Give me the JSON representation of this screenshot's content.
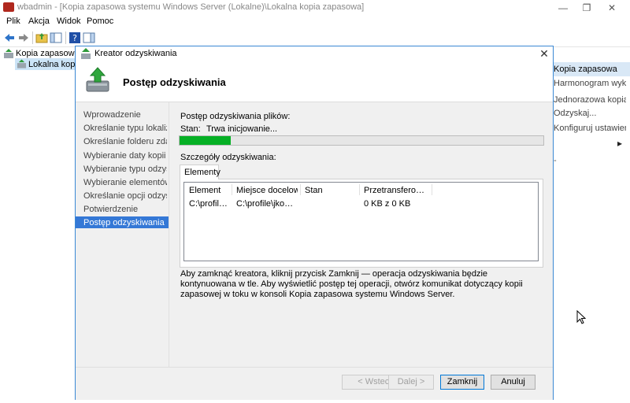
{
  "window": {
    "title": "wbadmin - [Kopia zapasowa systemu Windows Server (Lokalne)\\Lokalna kopia zapasowa]",
    "minimize": "—",
    "restore": "❐",
    "close": "✕"
  },
  "menu": [
    "Plik",
    "Akcja",
    "Widok",
    "Pomoc"
  ],
  "tree": {
    "root": "Kopia zapasowa systemu Windows Server (Lokalne)",
    "child": "Lokalna kopia zapasowa"
  },
  "actions": {
    "header": "Kopia zapasowa",
    "items": [
      "Harmonogram wykonywania kopii",
      "Jednorazowa kopia zapasowa...",
      "Odzyskaj...",
      "Konfiguruj ustawienia wydajności..."
    ],
    "submenu_arrow": "▸",
    "dash": "-"
  },
  "dialog": {
    "title": "Kreator odzyskiwania",
    "close": "✕",
    "heading": "Postęp odzyskiwania",
    "nav": [
      "Wprowadzenie",
      "Określanie typu lokalizacji",
      "Określanie folderu zdalnego",
      "Wybieranie daty kopii zapasowej",
      "Wybieranie typu odzyskiwania",
      "Wybieranie elementów do odzyskania",
      "Określanie opcji odzyskiwania",
      "Potwierdzenie",
      "Postęp odzyskiwania"
    ],
    "progress_label": "Postęp odzyskiwania plików:",
    "status_label": "Stan:",
    "status_value": "Trwa inicjowanie...",
    "progress_fraction": 0.14,
    "details_label": "Szczegóły odzyskiwania:",
    "tab_label": "Elementy",
    "columns": [
      "Element",
      "Miejsce docelowe",
      "Stan",
      "Przetransferowano"
    ],
    "row": [
      "C:\\profile\\jkowalski",
      "C:\\profile\\jkowalski",
      "",
      "0 KB z 0 KB"
    ],
    "info": "Aby zamknąć kreatora, kliknij przycisk Zamknij — operacja odzyskiwania będzie kontynuowana w tle. Aby wyświetlić postęp tej operacji, otwórz komunikat dotyczący kopii zapasowej w toku w konsoli Kopia zapasowa systemu Windows Server.",
    "buttons": {
      "back": "< Wstecz",
      "next": "Dalej >",
      "close": "Zamknij",
      "cancel": "Anuluj"
    }
  },
  "colors": {
    "progress": "#06b025",
    "selection": "#3478d6",
    "accent_border": "#3a88d4"
  }
}
